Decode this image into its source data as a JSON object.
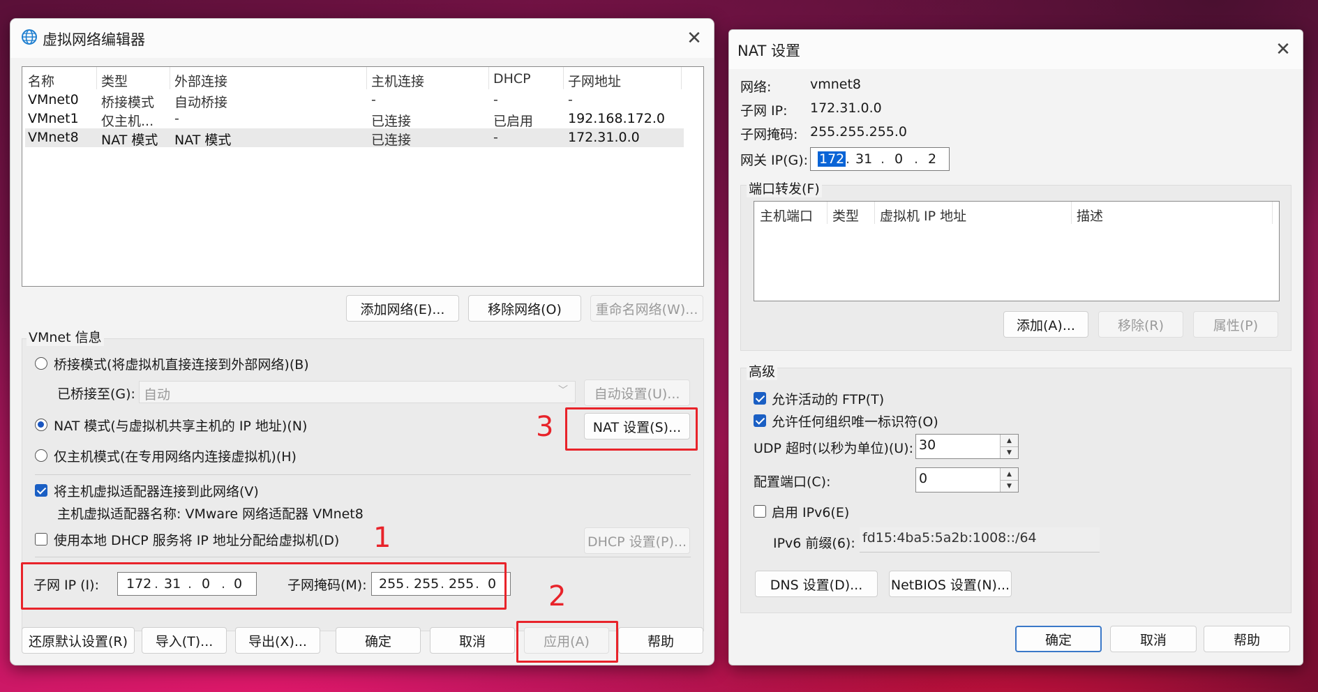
{
  "left_window": {
    "title": "虚拟网络编辑器",
    "close": "✕",
    "table": {
      "headers": [
        "名称",
        "类型",
        "外部连接",
        "主机连接",
        "DHCP",
        "子网地址"
      ],
      "rows": [
        [
          "VMnet0",
          "桥接模式",
          "自动桥接",
          "-",
          "-",
          "-"
        ],
        [
          "VMnet1",
          "仅主机...",
          "-",
          "已连接",
          "已启用",
          "192.168.172.0"
        ],
        [
          "VMnet8",
          "NAT 模式",
          "NAT 模式",
          "已连接",
          "-",
          "172.31.0.0"
        ]
      ]
    },
    "add_network": "添加网络(E)...",
    "remove_network": "移除网络(O)",
    "rename_network": "重命名网络(W)...",
    "vmnet_info": "VMnet 信息",
    "bridge_mode": "桥接模式(将虚拟机直接连接到外部网络)(B)",
    "bridged_to_label": "已桥接至(G):",
    "bridged_to_value": "自动",
    "auto_settings": "自动设置(U)...",
    "nat_mode": "NAT 模式(与虚拟机共享主机的 IP 地址)(N)",
    "nat_settings": "NAT 设置(S)...",
    "host_only_mode": "仅主机模式(在专用网络内连接虚拟机)(H)",
    "connect_adapter": "将主机虚拟适配器连接到此网络(V)",
    "adapter_name": "主机虚拟适配器名称: VMware 网络适配器 VMnet8",
    "use_dhcp": "使用本地 DHCP 服务将 IP 地址分配给虚拟机(D)",
    "dhcp_settings": "DHCP 设置(P)...",
    "subnet_ip_label": "子网 IP (I):",
    "subnet_ip": [
      "172",
      "31",
      "0",
      "0"
    ],
    "subnet_mask_label": "子网掩码(M):",
    "subnet_mask": [
      "255",
      "255",
      "255",
      "0"
    ],
    "restore_defaults": "还原默认设置(R)",
    "import": "导入(T)...",
    "export": "导出(X)...",
    "ok": "确定",
    "cancel": "取消",
    "apply": "应用(A)",
    "help": "帮助"
  },
  "annotations": {
    "one": "1",
    "two": "2",
    "three": "3",
    "color": "#e8232a"
  },
  "right_window": {
    "title": "NAT 设置",
    "close": "✕",
    "network_label": "网络:",
    "network_value": "vmnet8",
    "subnet_ip_label": "子网 IP:",
    "subnet_ip_value": "172.31.0.0",
    "subnet_mask_label": "子网掩码:",
    "subnet_mask_value": "255.255.255.0",
    "gateway_label": "网关 IP(G):",
    "gateway": [
      "172",
      "31",
      "0",
      "2"
    ],
    "port_forwarding": "端口转发(F)",
    "pf_headers": [
      "主机端口",
      "类型",
      "虚拟机 IP 地址",
      "描述"
    ],
    "add": "添加(A)...",
    "remove": "移除(R)",
    "properties": "属性(P)",
    "advanced": "高级",
    "allow_active_ftp": "允许活动的 FTP(T)",
    "allow_any_uid": "允许任何组织唯一标识符(O)",
    "udp_timeout_label": "UDP 超时(以秒为单位)(U):",
    "udp_timeout_value": "30",
    "config_port_label": "配置端口(C):",
    "config_port_value": "0",
    "enable_ipv6": "启用 IPv6(E)",
    "ipv6_prefix_label": "IPv6 前缀(6):",
    "ipv6_prefix_value": "fd15:4ba5:5a2b:1008::/64",
    "dns_settings": "DNS 设置(D)...",
    "netbios_settings": "NetBIOS 设置(N)...",
    "ok": "确定",
    "cancel": "取消",
    "help": "帮助"
  }
}
